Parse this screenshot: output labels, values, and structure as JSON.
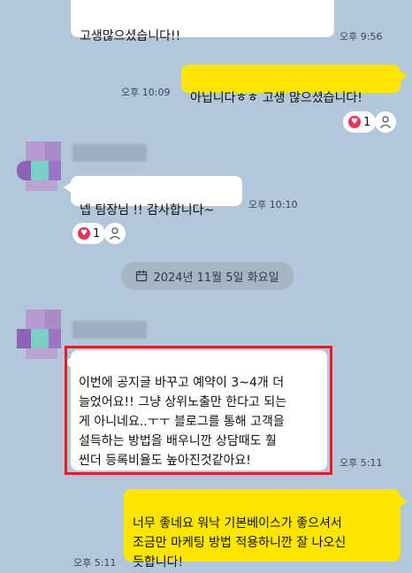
{
  "messages": {
    "m1": {
      "text": "고생많으셨습니다!!",
      "time": "오후 9:56"
    },
    "m2": {
      "text": "아닙니다ㅎㅎ 고생 많으셨습니다!",
      "time": "오후 10:09",
      "reaction_count": "1"
    },
    "m3": {
      "text": "넵 팀장님 !! 감사합니다~",
      "time": "오후 10:10",
      "reaction_count": "1"
    },
    "m4": {
      "text": "이번에 공지글 바꾸고 예약이 3~4개 더\n늘었어요!! 그냥 상위노출만 한다고 되는\n게 아니네요..ㅜㅜ 블로그를 통해 고객을\n 설득하는 방법을 배우니깐 상담때도 훨\n씬더 등록비율도 높아진것같아요!",
      "time": "오후 5:11"
    },
    "m5": {
      "text": "너무 좋네요 워낙 기본베이스가 좋으셔서\n조금만 마케팅 방법 적용하니깐 잘 나오신\n듯합니다!",
      "time": "오후 5:11"
    }
  },
  "date_divider": "2024년 11월 5일 화요일",
  "colors": {
    "background": "#b2c7d9",
    "my_bubble": "#fee500",
    "other_bubble": "#ffffff",
    "highlight_border": "#e0201c",
    "heart": "#e5335a"
  }
}
